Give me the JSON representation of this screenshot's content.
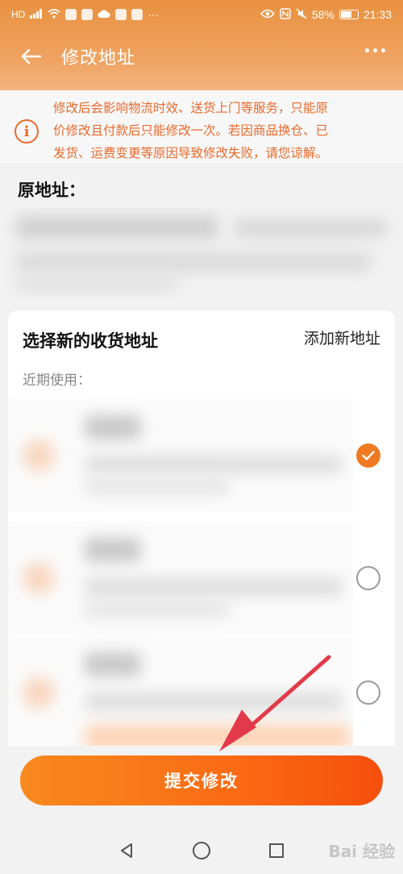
{
  "status_bar": {
    "left_icons": [
      "hd-icon",
      "signal-icon",
      "wifi-icon",
      "app-icon",
      "app-icon",
      "cloud-icon",
      "app-icon",
      "app-icon"
    ],
    "overflow": "···",
    "battery_percent": "58%",
    "time": "21:33"
  },
  "header": {
    "title": "修改地址"
  },
  "notice": {
    "text_line1": "修改后会影响物流时效、送货上门等服务，只能原",
    "text_line2": "价修改且付款后只能修改一次。若因商品换仓、已",
    "text_line3": "发货、运费变更等原因导致修改失败，请您谅解。"
  },
  "original_address": {
    "label": "原地址："
  },
  "new_address": {
    "title": "选择新的收货地址",
    "add_link": "添加新地址",
    "recent_label": "近期使用：",
    "items": [
      {
        "selected": true
      },
      {
        "selected": false
      },
      {
        "selected": false
      }
    ]
  },
  "submit": {
    "label": "提交修改"
  },
  "watermark": "Bai 经验",
  "colors": {
    "accent": "#f07a22",
    "notice_text": "#e86a2b",
    "button_start": "#f88a1e",
    "button_end": "#f54f0c"
  }
}
